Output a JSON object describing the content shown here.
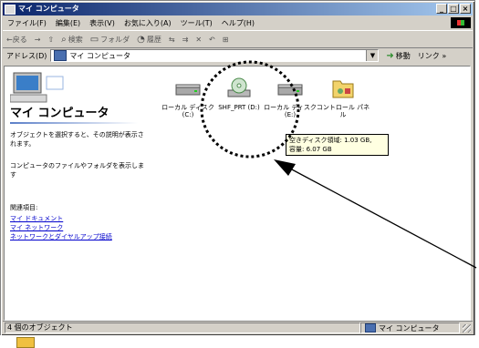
{
  "window": {
    "title": "マイ コンピュータ",
    "controls": [
      "_",
      "□",
      "×"
    ]
  },
  "menu": [
    "ファイル(F)",
    "編集(E)",
    "表示(V)",
    "お気に入り(A)",
    "ツール(T)",
    "ヘルプ(H)"
  ],
  "toolbar": {
    "back": "←戻る",
    "forward": "→",
    "up": "⇧",
    "search": "検索",
    "folders": "フォルダ",
    "history": "履歴",
    "move": "⇆",
    "copy": "⇉",
    "delete": "✕",
    "undo": "↶",
    "views": "⊞"
  },
  "address": {
    "label": "アドレス(D)",
    "value": "マイ コンピュータ",
    "go": "移動",
    "links": "リンク »"
  },
  "left": {
    "title": "マイ コンピュータ",
    "desc1": "オブジェクトを選択すると、その説明が表示されます。",
    "desc2": "コンピュータのファイルやフォルダを表示します",
    "related_heading": "関連項目:",
    "links": [
      "マイ ドキュメント",
      "マイ ネットワーク",
      "ネットワークとダイヤルアップ接続"
    ]
  },
  "icons": [
    {
      "label": "ローカル ディスク (C:)",
      "icon": "hard-disk-icon"
    },
    {
      "label": "SHF_PRT (D:)",
      "icon": "cd-drive-icon"
    },
    {
      "label": "ローカル ディスク (E:)",
      "icon": "hard-disk-icon"
    },
    {
      "label": "コントロール パネル",
      "icon": "control-panel-icon"
    }
  ],
  "tooltip": {
    "line1": "空きディスク領域: 1.03 GB,",
    "line2": "容量: 6.07 GB"
  },
  "status": {
    "left": "4 個のオブジェクト",
    "right": "マイ コンピュータ"
  }
}
